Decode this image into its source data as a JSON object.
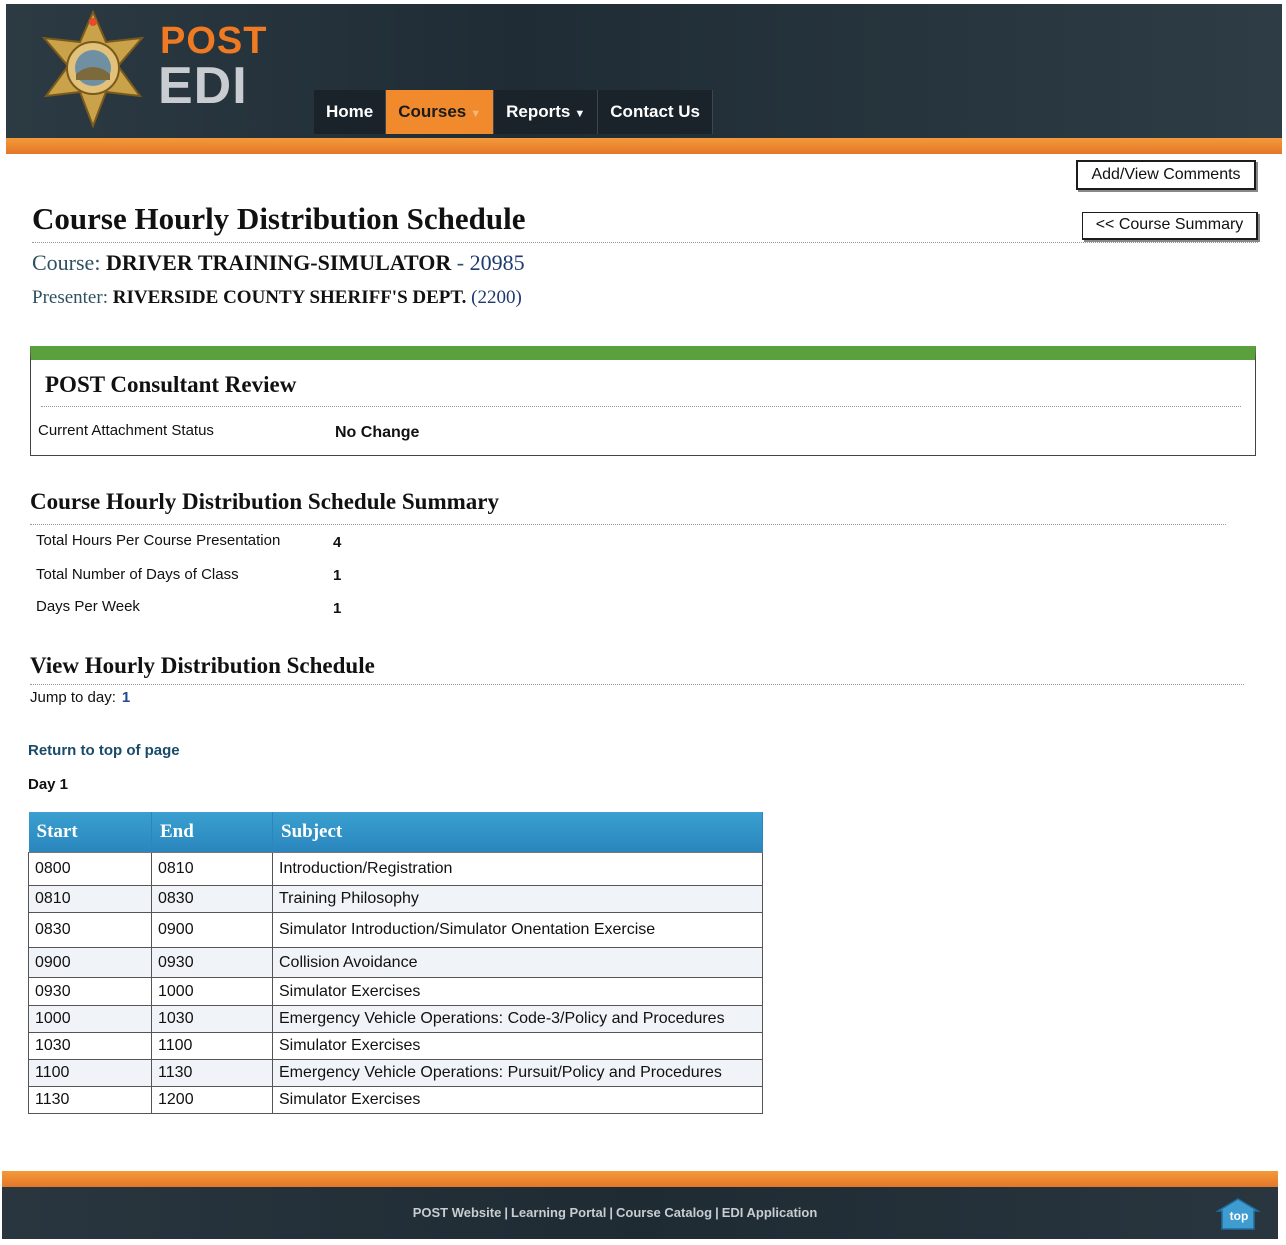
{
  "header": {
    "logo_top": "POST",
    "logo_bottom": "EDI",
    "nav": [
      {
        "label": "Home",
        "active": false,
        "has_dropdown": false
      },
      {
        "label": "Courses",
        "active": true,
        "has_dropdown": true
      },
      {
        "label": "Reports",
        "active": false,
        "has_dropdown": true
      },
      {
        "label": "Contact Us",
        "active": false,
        "has_dropdown": false
      }
    ]
  },
  "actions": {
    "add_comments": "Add/View Comments",
    "course_summary": "<< Course Summary"
  },
  "page": {
    "title": "Course Hourly Distribution Schedule",
    "course_label": "Course:",
    "course_name": "DRIVER TRAINING-SIMULATOR",
    "course_sep": " - ",
    "course_number": "20985",
    "presenter_label": "Presenter:",
    "presenter_name": "RIVERSIDE COUNTY SHERIFF'S DEPT.",
    "presenter_number": "(2200)"
  },
  "review": {
    "title": "POST Consultant Review",
    "status_label": "Current Attachment Status",
    "status_value": "No Change"
  },
  "summary": {
    "title": "Course Hourly Distribution Schedule Summary",
    "rows": [
      {
        "label": "Total Hours Per Course Presentation",
        "value": "4"
      },
      {
        "label": "Total Number of Days of Class",
        "value": "1"
      },
      {
        "label": "Days Per Week",
        "value": "1"
      }
    ]
  },
  "schedule": {
    "title": "View Hourly Distribution Schedule",
    "jump_label": "Jump to day:",
    "jump_day": "1",
    "return_link": "Return to top of page",
    "day_label": "Day 1",
    "columns": [
      "Start",
      "End",
      "Subject"
    ],
    "rows": [
      [
        "0800",
        "0810",
        "Introduction/Registration"
      ],
      [
        "0810",
        "0830",
        "Training Philosophy"
      ],
      [
        "0830",
        "0900",
        "Simulator Introduction/Simulator Onentation Exercise"
      ],
      [
        "0900",
        "0930",
        "Collision Avoidance"
      ],
      [
        "0930",
        "1000",
        "Simulator Exercises"
      ],
      [
        "1000",
        "1030",
        "Emergency Vehicle Operations: Code-3/Policy and Procedures"
      ],
      [
        "1030",
        "1100",
        "Simulator Exercises"
      ],
      [
        "1100",
        "1130",
        "Emergency Vehicle Operations: Pursuit/Policy and Procedures"
      ],
      [
        "1130",
        "1200",
        "Simulator Exercises"
      ]
    ]
  },
  "footer": {
    "links": [
      "POST Website",
      "Learning Portal",
      "Course Catalog",
      "EDI Application"
    ],
    "top_label": "top"
  },
  "colors": {
    "header_dark": "#1f2c35",
    "accent_orange": "#f08a2c",
    "review_green": "#5aa03c",
    "table_header_blue": "#2a86bd"
  },
  "icons": [
    "badge-logo-icon",
    "dropdown-caret-icon",
    "top-arrow-icon"
  ]
}
